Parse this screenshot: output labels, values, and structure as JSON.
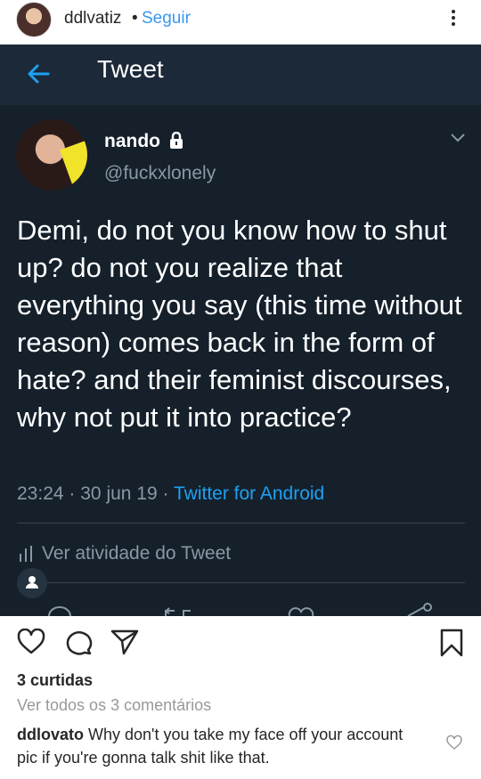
{
  "instagram": {
    "username": "ddlvatiz",
    "separator": "•",
    "follow_label": "Seguir",
    "likes_label": "3 curtidas",
    "view_comments_label": "Ver todos os 3 comentários",
    "comment": {
      "username": "ddlovato",
      "text": "Why don't you take my face off your account pic if you're gonna talk shit like that."
    },
    "icons": [
      "more-icon",
      "heart-icon",
      "comment-icon",
      "share-icon",
      "bookmark-icon",
      "small-heart-icon"
    ]
  },
  "tweet": {
    "page_title": "Tweet",
    "author_name": "nando",
    "author_handle": "@fuckxlonely",
    "text": "Demi, do not you know how to shut up?  do not you realize that everything you say (this time without reason) comes back in the form of hate? and their feminist discourses, why not put it into practice?",
    "time": "23:24",
    "dot": "·",
    "date": "30 jun 19",
    "source": "Twitter for Android",
    "activity_label": "Ver atividade do Tweet",
    "colors": {
      "background": "#15202b",
      "header": "#1c2938",
      "accent": "#1da1f2",
      "muted": "#8899a6"
    }
  }
}
